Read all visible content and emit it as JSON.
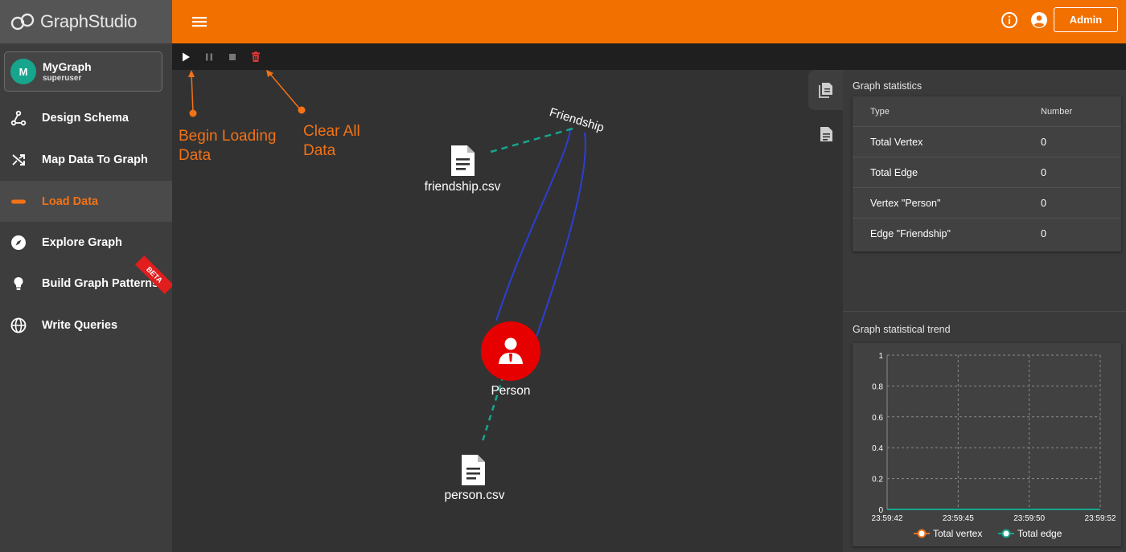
{
  "app": {
    "logo_text": "GraphStudio"
  },
  "graph_select": {
    "avatar_letter": "M",
    "name": "MyGraph",
    "user": "superuser"
  },
  "sidebar": {
    "items": [
      {
        "label": "Design Schema",
        "icon": "design-schema-icon",
        "active": false
      },
      {
        "label": "Map Data To Graph",
        "icon": "shuffle-icon",
        "active": false
      },
      {
        "label": "Load Data",
        "icon": "load-data-icon",
        "active": true
      },
      {
        "label": "Explore Graph",
        "icon": "compass-icon",
        "active": false
      },
      {
        "label": "Build Graph Patterns",
        "icon": "lightbulb-icon",
        "active": false,
        "badge": "BETA"
      },
      {
        "label": "Write Queries",
        "icon": "globe-icon",
        "active": false
      }
    ]
  },
  "topbar": {
    "admin_label": "Admin"
  },
  "annotations": {
    "begin": [
      "Begin Loading",
      "Data"
    ],
    "clear": [
      "Clear All",
      "Data"
    ]
  },
  "graph": {
    "edge_label": "Friendship",
    "vertex_label": "Person",
    "file_friendship": "friendship.csv",
    "file_person": "person.csv"
  },
  "stats": {
    "title": "Graph statistics",
    "header": {
      "type": "Type",
      "number": "Number"
    },
    "rows": [
      {
        "type": "Total Vertex",
        "number": "0"
      },
      {
        "type": "Total Edge",
        "number": "0"
      },
      {
        "type": "Vertex \"Person\"",
        "number": "0"
      },
      {
        "type": "Edge \"Friendship\"",
        "number": "0"
      }
    ]
  },
  "trend": {
    "title": "Graph statistical trend"
  },
  "colors": {
    "accent": "#f27000",
    "vertex": "#e60000",
    "edge": "#2b3fd4",
    "file_link": "#17a58e",
    "series_vertex": "#f27216",
    "series_edge": "#17a58e"
  },
  "chart_data": {
    "type": "line",
    "title": "",
    "xlabel": "",
    "ylabel": "",
    "x": [
      "23:59:42",
      "23:59:45",
      "23:59:50",
      "23:59:52"
    ],
    "x_ticks": [
      "23:59:42",
      "23:59:45",
      "23:59:50",
      "23:59:52"
    ],
    "y_ticks": [
      "0",
      "0.2",
      "0.4",
      "0.6",
      "0.8",
      "1"
    ],
    "ylim": [
      0,
      1
    ],
    "grid": true,
    "legend": "bottom",
    "series": [
      {
        "name": "Total vertex",
        "values": [
          0,
          0,
          0,
          0
        ]
      },
      {
        "name": "Total edge",
        "values": [
          0,
          0,
          0,
          0
        ]
      }
    ]
  }
}
